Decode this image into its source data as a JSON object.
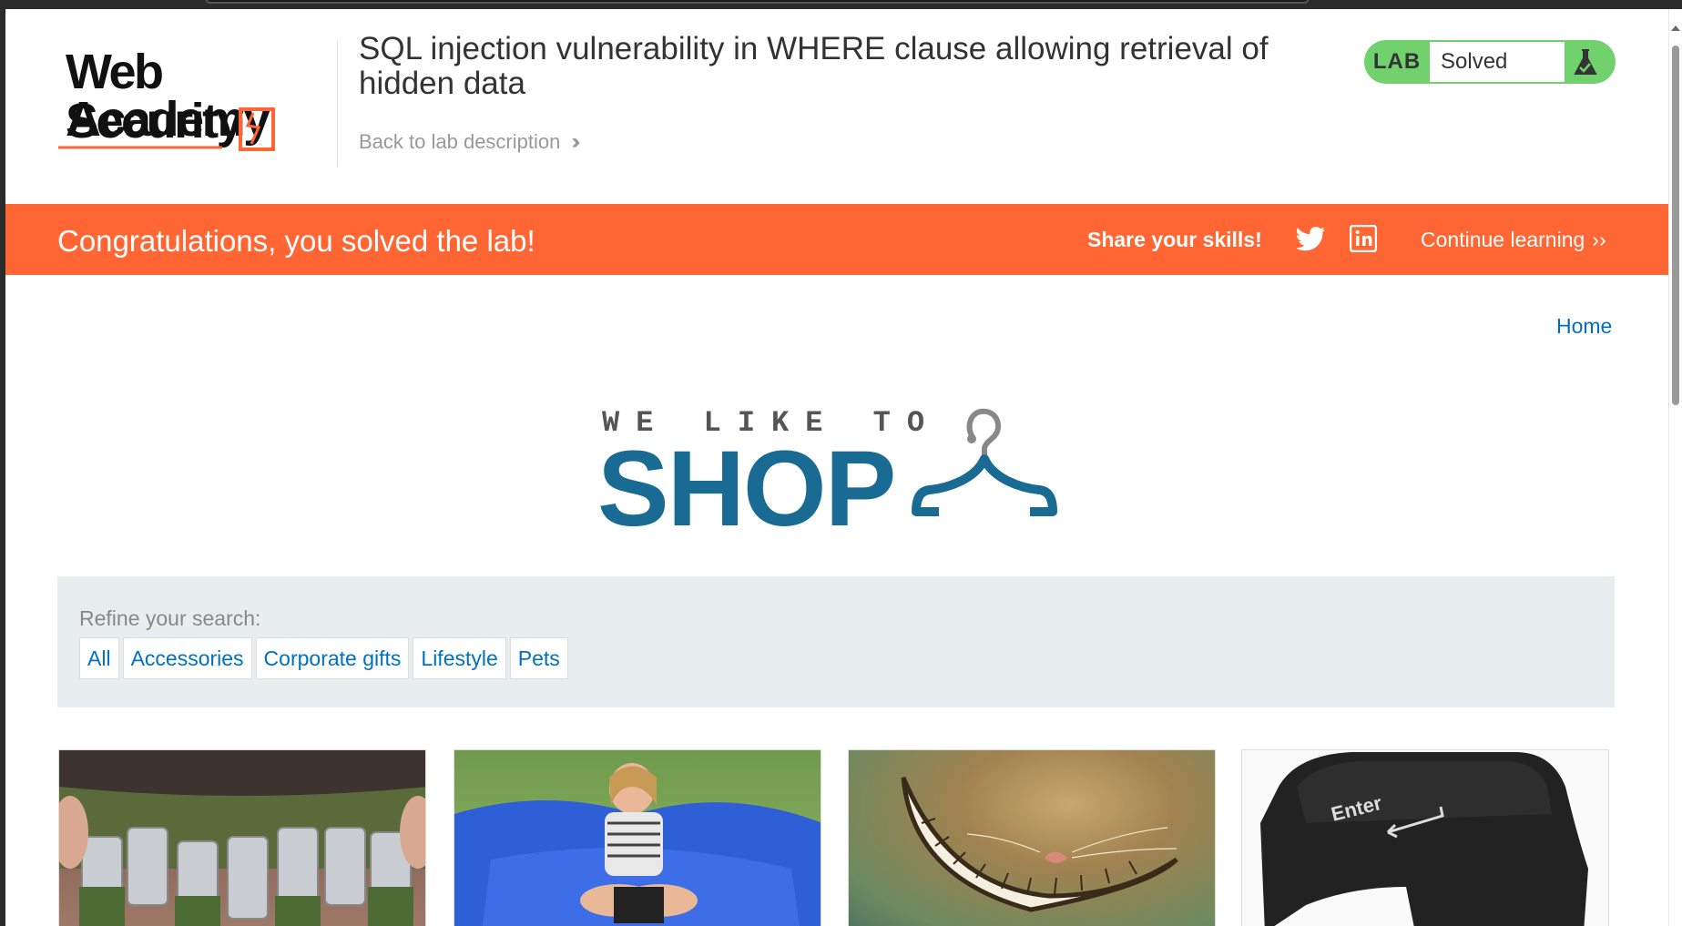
{
  "academy": {
    "logo_line1": "Web Security",
    "logo_line2": "Academy",
    "lab_title": "SQL injection vulnerability in WHERE clause allowing retrieval of hidden data",
    "back_link": "Back to lab description",
    "status_label": "LAB",
    "status_text": "Solved"
  },
  "banner": {
    "message": "Congratulations, you solved the lab!",
    "share": "Share your skills!",
    "continue": "Continue learning",
    "color": "#ff6633"
  },
  "site": {
    "home_link": "Home",
    "logo_tag": "WE LIKE TO",
    "logo_main": "SHOP",
    "brand_color": "#1a6b94",
    "link_color": "#0071bc"
  },
  "filter": {
    "refine_label": "Refine your search:",
    "categories": [
      "All",
      "Accessories",
      "Corporate gifts",
      "Lifestyle",
      "Pets"
    ]
  },
  "products": [
    {
      "image": "beer-belt"
    },
    {
      "image": "giant-beanbag"
    },
    {
      "image": "cheshire-grin"
    },
    {
      "image": "enter-key-pillow"
    }
  ]
}
